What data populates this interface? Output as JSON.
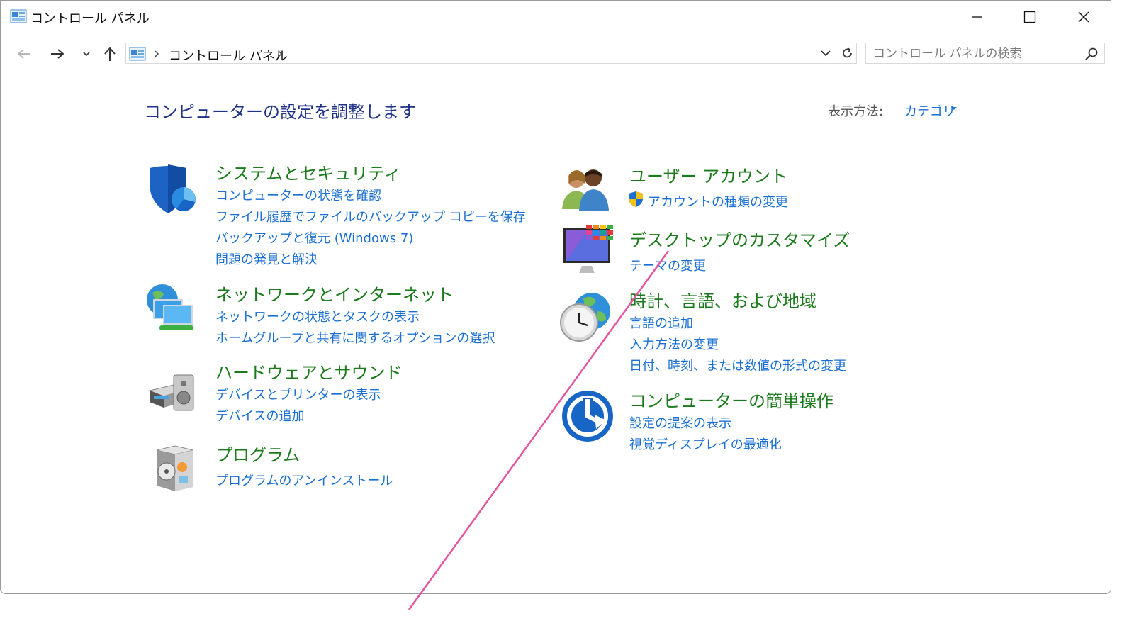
{
  "window": {
    "title": "コントロール パネル"
  },
  "address": {
    "crumb": "コントロール パネル"
  },
  "search": {
    "placeholder": "コントロール パネルの検索"
  },
  "page": {
    "heading": "コンピューターの設定を調整します",
    "view_by_label": "表示方法:",
    "view_by_value": "カテゴリ"
  },
  "categories": {
    "system": {
      "title": "システムとセキュリティ",
      "links": [
        "コンピューターの状態を確認",
        "ファイル履歴でファイルのバックアップ コピーを保存",
        "バックアップと復元 (Windows 7)",
        "問題の発見と解決"
      ]
    },
    "network": {
      "title": "ネットワークとインターネット",
      "links": [
        "ネットワークの状態とタスクの表示",
        "ホームグループと共有に関するオプションの選択"
      ]
    },
    "hardware": {
      "title": "ハードウェアとサウンド",
      "links": [
        "デバイスとプリンターの表示",
        "デバイスの追加"
      ]
    },
    "programs": {
      "title": "プログラム",
      "links": [
        "プログラムのアンインストール"
      ]
    },
    "users": {
      "title": "ユーザー アカウント",
      "links": [
        "アカウントの種類の変更"
      ]
    },
    "desktop": {
      "title": "デスクトップのカスタマイズ",
      "links": [
        "テーマの変更"
      ]
    },
    "clock": {
      "title": "時計、言語、および地域",
      "links": [
        "言語の追加",
        "入力方法の変更",
        "日付、時刻、または数値の形式の変更"
      ]
    },
    "ease": {
      "title": "コンピューターの簡単操作",
      "links": [
        "設定の提案の表示",
        "視覚ディスプレイの最適化"
      ]
    }
  },
  "colors": {
    "title_green": "#1b7a1b",
    "link_blue": "#1a6fd1",
    "heading_navy": "#1e3287",
    "annotation_pink": "#e5559e"
  }
}
